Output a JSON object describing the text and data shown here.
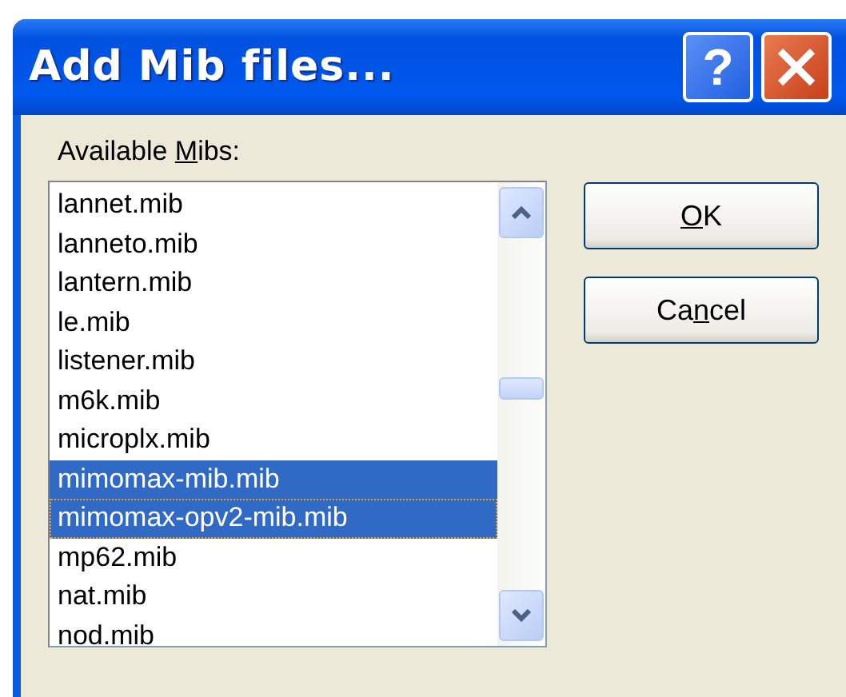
{
  "window": {
    "title": "Add Mib files...",
    "title_buttons": [
      {
        "kind": "help",
        "label": "?"
      },
      {
        "kind": "close"
      }
    ]
  },
  "list_label": {
    "before": "Available ",
    "underlined": "M",
    "after": "ibs:"
  },
  "items": [
    {
      "label": "lannet.mib",
      "selected": false,
      "focused": false
    },
    {
      "label": "lanneto.mib",
      "selected": false,
      "focused": false
    },
    {
      "label": "lantern.mib",
      "selected": false,
      "focused": false
    },
    {
      "label": "le.mib",
      "selected": false,
      "focused": false
    },
    {
      "label": "listener.mib",
      "selected": false,
      "focused": false
    },
    {
      "label": "m6k.mib",
      "selected": false,
      "focused": false
    },
    {
      "label": "microplx.mib",
      "selected": false,
      "focused": false
    },
    {
      "label": "mimomax-mib.mib",
      "selected": true,
      "focused": false
    },
    {
      "label": "mimomax-opv2-mib.mib",
      "selected": true,
      "focused": true
    },
    {
      "label": "mp62.mib",
      "selected": false,
      "focused": false
    },
    {
      "label": "nat.mib",
      "selected": false,
      "focused": false
    },
    {
      "label": "nod.mib",
      "selected": false,
      "focused": false
    }
  ],
  "buttons": [
    {
      "underlined": "O",
      "after": "K"
    },
    {
      "before": "Ca",
      "underlined": "n",
      "after": "cel"
    }
  ]
}
